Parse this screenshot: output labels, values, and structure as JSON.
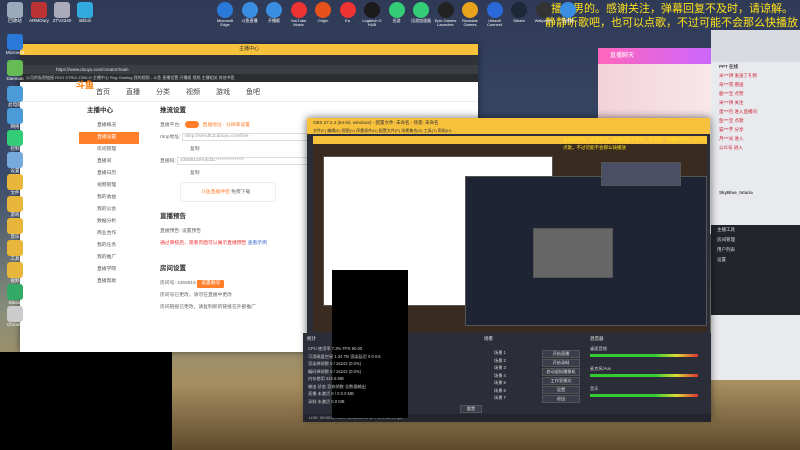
{
  "marquee": {
    "line1": "主播是男的。感谢关注，弹幕回复不及时，请谅解。",
    "line2": "静静听歌吧，也可以点歌，不过可能不会那么快播放"
  },
  "desktop_icons": [
    {
      "label": "回收站",
      "color": "#9ab"
    },
    {
      "label": "ARMOury",
      "color": "#b33"
    },
    {
      "label": "ZTV2340",
      "color": "#aab"
    },
    {
      "label": "Bilibili",
      "color": "#3ad"
    }
  ],
  "left_icons": [
    {
      "label": "Microsoft",
      "color": "#2a79d8"
    },
    {
      "label": "Daemon",
      "color": "#6b5"
    },
    {
      "label": "此电脑",
      "color": "#4a9bd8"
    },
    {
      "label": "网络",
      "color": "#4a9bd8"
    },
    {
      "label": "控制",
      "color": "#3c7"
    },
    {
      "label": "设置",
      "color": "#7ad"
    },
    {
      "label": "文件",
      "color": "#e8b63a"
    },
    {
      "label": "游戏",
      "color": "#e8b63a"
    },
    {
      "label": "音乐",
      "color": "#e8b63a"
    },
    {
      "label": "工具",
      "color": "#e8b63a"
    },
    {
      "label": "视频",
      "color": "#e8b63a"
    },
    {
      "label": "Steam",
      "color": "#3a6"
    },
    {
      "label": "Chrome",
      "color": "#ccc"
    }
  ],
  "top_icons": [
    {
      "label": "Microsoft Edge",
      "color": "#2a79d8"
    },
    {
      "label": "斗鱼直播",
      "color": "#3a8de0"
    },
    {
      "label": "开播姬",
      "color": "#3a8de0"
    },
    {
      "label": "YouTube Music",
      "color": "#e33"
    },
    {
      "label": "Origin",
      "color": "#e5531a"
    },
    {
      "label": "Ea",
      "color": "#e33"
    },
    {
      "label": "Logitech G HUB",
      "color": "#1a1a1a"
    },
    {
      "label": "迅游",
      "color": "#3c7"
    },
    {
      "label": "迅游加速器",
      "color": "#3c7"
    },
    {
      "label": "Epic Games Launcher",
      "color": "#222"
    },
    {
      "label": "Rockstar Games",
      "color": "#e8a21c"
    },
    {
      "label": "Ubisoft Connect",
      "color": "#2a6ad8"
    },
    {
      "label": "Steam",
      "color": "#1b2838"
    },
    {
      "label": "Wallpaper",
      "color": "#333"
    },
    {
      "label": "直播姬",
      "color": "#3a8de0"
    }
  ],
  "browser": {
    "window_title": "主播中心",
    "address": "https://www.douyu.com/creator/main",
    "bookmarks": "公司的私密链接   ROG STRIX Z390-G   主播中心   Rog Gaming   我的视频 - 斗鱼   直播设置   开播姬   视频   主播相关   其他书签",
    "nav": [
      "首页",
      "直播",
      "分类",
      "视频",
      "游戏",
      "鱼吧"
    ],
    "logo": "斗鱼",
    "sidebar": {
      "title": "主播中心",
      "items": [
        "直播概况",
        "直播设置",
        "房间管理",
        "直播间",
        "直播日历",
        "视频管理",
        "我的收益",
        "我的公会",
        "数据分析",
        "商业合作",
        "我的任务",
        "我的推广",
        "直播学院",
        "直播帮助"
      ],
      "active_index": 1
    },
    "main": {
      "section1": "推流设置",
      "rows": [
        {
          "label": "直播平台:",
          "value": "直播地址  ·  分辨率设置"
        },
        {
          "label": "rtmp地址:",
          "value": "rtmp://sendtc3.douyu.com/live"
        },
        {
          "label": "",
          "value": "复制"
        },
        {
          "label": "直播码:",
          "value": "4358915rhnkd3c***************"
        },
        {
          "label": "",
          "value": "复制"
        }
      ],
      "banner": "斗鱼直播伴侣",
      "banner_link": "免费下载",
      "section2": "直播预告",
      "preview_label": "直播预告:",
      "preview_value": "设置预告",
      "preview_note": "通过审核后，观看页面可以展示直播预告",
      "preview_link": "查看示例",
      "section3": "房间设置",
      "room_label": "房间号:",
      "room_value": "4358915",
      "room_btn": "设置靓号",
      "room_note": "房间号已更改，请勿在直播中更改",
      "room_note2": "房间链接已更改，请复制新的链接在外部推广"
    }
  },
  "side_panel": {
    "header": "PPT 在线",
    "rows": [
      "米***饼 发送了礼物",
      "朵***雪 赠送",
      "鹿***宝 点赞",
      "米***饼 关注",
      "蛋***包 进入直播间",
      "鱼***宝 点歌",
      "猫***芋 分享",
      "月***光 进入",
      "公众号 进入"
    ],
    "chat_header": "直播聊天",
    "user": "SkyBlue_tstaria"
  },
  "side_panel2": {
    "rows": [
      "主播工具",
      "房间管理",
      "用户列表",
      "设置"
    ]
  },
  "obs": {
    "window_title": "OBS 27.2.4 (64-bit, windows) - 配置文件: 未命名 - 场景: 未命名",
    "menu": "文件(F)  编辑(E)  视图(V)  停靠部件(D)  配置文件(P)  场景集合(S)  工具(T)  帮助(H)",
    "preview_caption": "主播是男的，感谢关注，弹幕回复不及时，请谅解。静静听歌吧，也可以点歌，不过可能不会那么快播放",
    "dock_stats": "统计",
    "dock_scenes": "场景",
    "dock_sources": "来源",
    "dock_mixer": "混音器",
    "dock_controls": "控制按钮",
    "stats": [
      "CPU 使用率  7.3%   FPS  60.00",
      "可用磁盘空间  1.34 TB   渲染延迟  0.0 ms",
      "渲染掉帧数  0 / 16243 (0.0%)",
      "编码掉帧数  0 / 16243 (0.0%)",
      "内存使用  342.6 MB",
      "输出  状态  丢弃帧数  总数据输出",
      "直播  未激活  0 / 0   0.0 MB",
      "录制  未激活  0.0 MB"
    ],
    "reset_btn": "重置",
    "scenes": [
      "场景 1",
      "场景 2",
      "场景 3",
      "场景 4",
      "场景 5",
      "场景 6",
      "场景 7"
    ],
    "controls": [
      "开始直播",
      "开始录制",
      "启动虚拟摄像机",
      "工作室模式",
      "设置",
      "退出"
    ],
    "mixer": [
      "桌面音频",
      "麦克风/Aux",
      "音乐"
    ],
    "status": "LIVE: 00:00:00   REC: 00:00:00   CPU: 7.3%, 60.00 fps"
  }
}
